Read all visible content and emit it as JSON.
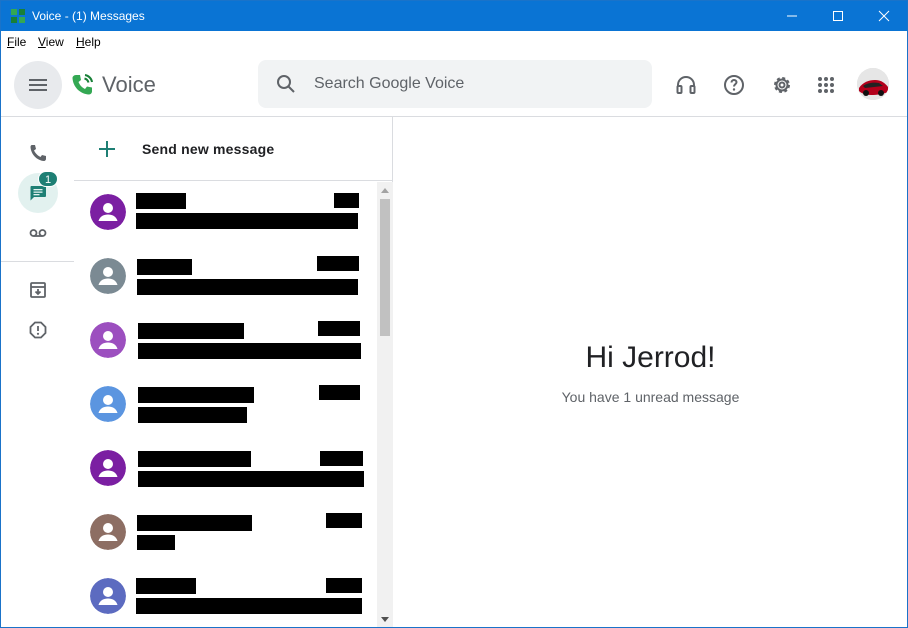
{
  "window": {
    "title": "Voice - (1) Messages",
    "accent_color": "#0a74d4"
  },
  "menu": {
    "items": [
      {
        "mnemonic": "F",
        "rest": "ile"
      },
      {
        "mnemonic": "V",
        "rest": "iew"
      },
      {
        "mnemonic": "H",
        "rest": "elp"
      }
    ]
  },
  "header": {
    "brand": "Voice",
    "search_placeholder": "Search Google Voice",
    "icons": [
      "headset-icon",
      "help-icon",
      "settings-icon",
      "apps-grid-icon"
    ]
  },
  "rail": {
    "items": [
      {
        "name": "calls",
        "icon": "phone-icon"
      },
      {
        "name": "messages",
        "icon": "message-icon",
        "badge": "1",
        "active": true
      },
      {
        "name": "voicemail",
        "icon": "voicemail-icon"
      },
      {
        "name": "archive",
        "icon": "archive-icon"
      },
      {
        "name": "spam",
        "icon": "spam-icon"
      }
    ]
  },
  "list": {
    "send_new_label": "Send new message",
    "conversations": [
      {
        "avatar_color": "#7b1fa2"
      },
      {
        "avatar_color": "#7b8a93"
      },
      {
        "avatar_color": "#9c4fbf"
      },
      {
        "avatar_color": "#5b95e0"
      },
      {
        "avatar_color": "#7b1fa2"
      },
      {
        "avatar_color": "#8d6e63"
      },
      {
        "avatar_color": "#5c6bc0"
      }
    ]
  },
  "main": {
    "greeting": "Hi Jerrod!",
    "unread_text": "You have 1 unread message"
  }
}
